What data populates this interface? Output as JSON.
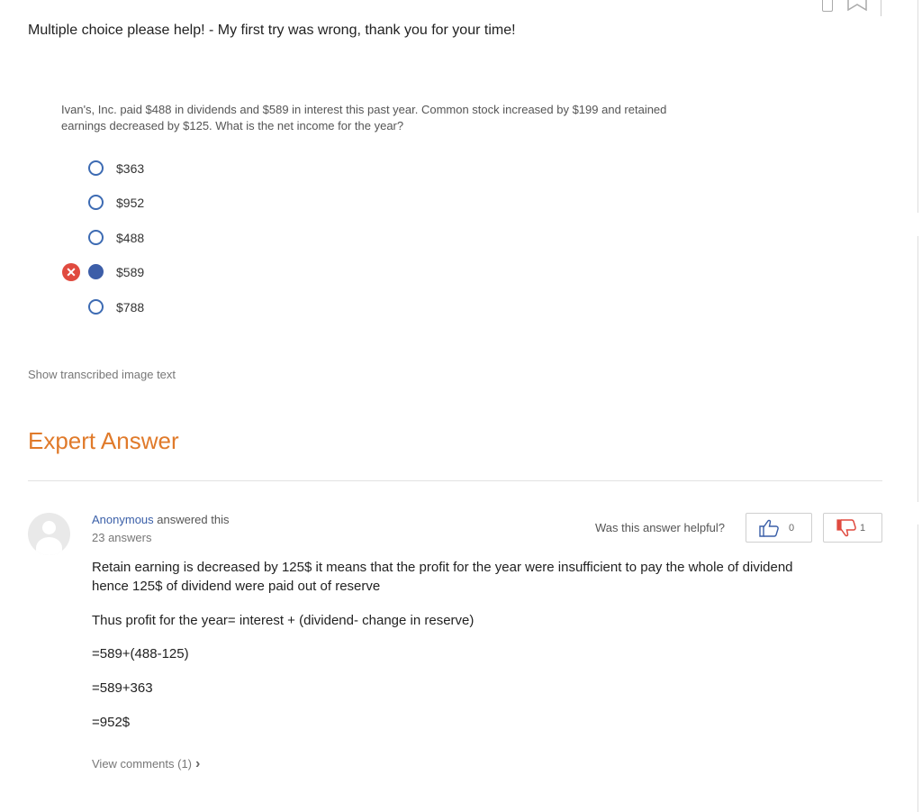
{
  "question": {
    "title": "Multiple choice please help! - My first try was wrong, thank you for your time!",
    "text": "Ivan's, Inc. paid $488 in dividends and $589 in interest this past year. Common stock increased by $199 and retained earnings decreased by $125. What is the net income for the year?",
    "options": [
      {
        "label": "$363",
        "selected": false
      },
      {
        "label": "$952",
        "selected": false
      },
      {
        "label": "$488",
        "selected": false
      },
      {
        "label": "$589",
        "selected": true,
        "marked_wrong": true
      },
      {
        "label": "$788",
        "selected": false
      }
    ],
    "show_transcribed": "Show transcribed image text"
  },
  "expert": {
    "heading": "Expert Answer",
    "answerer_name": "Anonymous",
    "answered_text": " answered this",
    "answer_count": "23 answers",
    "helpful_label": "Was this answer helpful?",
    "upvotes": "0",
    "downvotes": "1",
    "paragraphs": [
      "Retain earning is decreased by 125$ it means that the profit for the year were insufficient to pay the whole of dividend hence 125$ of dividend were paid out of reserve",
      "Thus profit for the year= interest + (dividend- change in reserve)",
      "=589+(488-125)",
      "=589+363",
      "=952$"
    ],
    "view_comments": "View comments (1)"
  },
  "colors": {
    "accent_orange": "#e07a2a",
    "link_blue": "#3a5fa8",
    "radio_blue": "#3d5ea8",
    "wrong_red": "#e04a3f"
  }
}
